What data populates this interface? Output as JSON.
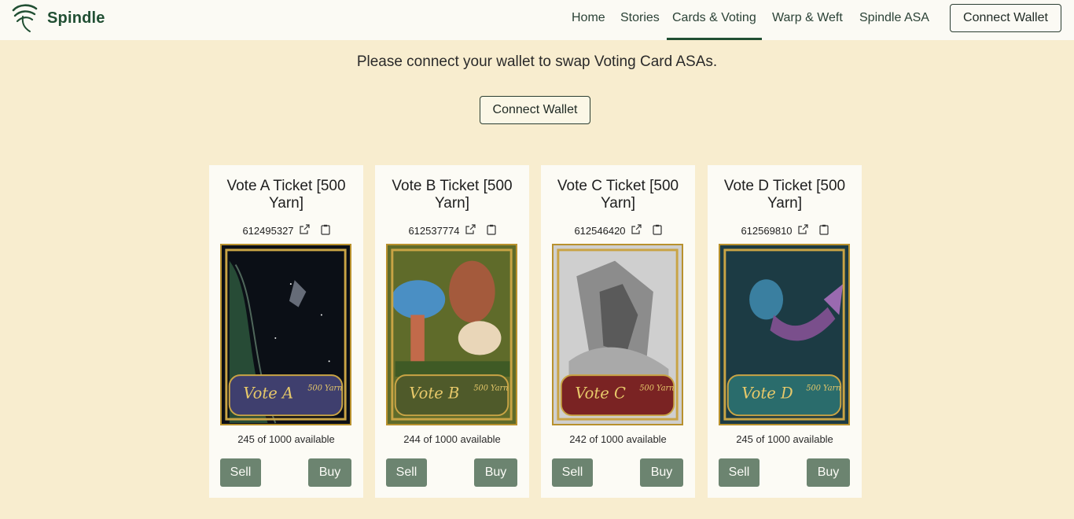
{
  "brand": {
    "name": "Spindle",
    "logo_icon": "spindle-logo-icon"
  },
  "nav": {
    "home": "Home",
    "stories": "Stories",
    "cards": "Cards & Voting",
    "warp": "Warp & Weft",
    "asa": "Spindle ASA",
    "connect": "Connect Wallet",
    "active": "Cards & Voting"
  },
  "notice": {
    "message": "Please connect your wallet to swap Voting Card ASAs.",
    "connect": "Connect Wallet"
  },
  "cards": [
    {
      "title": "Vote A Ticket [500 Yarn]",
      "asa_id": "612495327",
      "availability": "245 of 1000 available",
      "sell": "Sell",
      "buy": "Buy",
      "art_banner": "Vote A",
      "art_sub": "500 Yarn",
      "banner_color": "#3f3f6e"
    },
    {
      "title": "Vote B Ticket [500 Yarn]",
      "asa_id": "612537774",
      "availability": "244 of 1000 available",
      "sell": "Sell",
      "buy": "Buy",
      "art_banner": "Vote B",
      "art_sub": "500 Yarn",
      "banner_color": "#4f5a2a"
    },
    {
      "title": "Vote C Ticket [500 Yarn]",
      "asa_id": "612546420",
      "availability": "242 of 1000 available",
      "sell": "Sell",
      "buy": "Buy",
      "art_banner": "Vote C",
      "art_sub": "500 Yarn",
      "banner_color": "#7a2323"
    },
    {
      "title": "Vote D Ticket [500 Yarn]",
      "asa_id": "612569810",
      "availability": "245 of 1000 available",
      "sell": "Sell",
      "buy": "Buy",
      "art_banner": "Vote D",
      "art_sub": "500 Yarn",
      "banner_color": "#2a6c6c"
    }
  ],
  "colors": {
    "background": "#f8edcf",
    "brand_green": "#214f33",
    "button_green": "#6c8470",
    "card_frame_gold": "#b8912e"
  }
}
